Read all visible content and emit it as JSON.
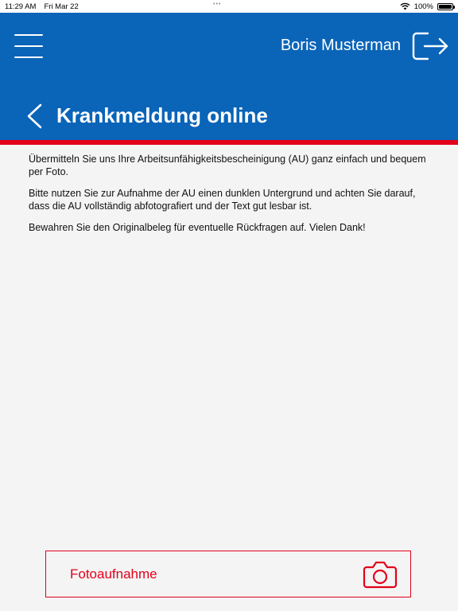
{
  "status_bar": {
    "time": "11:29 AM",
    "date": "Fri Mar 22",
    "battery": "100%",
    "dots": "•••"
  },
  "header": {
    "user_name": "Boris Musterman",
    "title": "Krankmeldung online",
    "background_color": "#0a64b8",
    "accent_color": "#e3001b",
    "menu_icon": "hamburger-menu-icon",
    "logout_icon": "logout-icon",
    "back_icon": "chevron-left-icon"
  },
  "content": {
    "paragraphs": [
      "Übermitteln Sie uns Ihre Arbeitsunfähigkeitsbescheinigung (AU) ganz einfach und bequem per Foto.",
      "Bitte nutzen Sie zur Aufnahme der AU einen dunklen Untergrund und achten Sie darauf, dass die AU vollständig abfotografiert und der Text gut lesbar ist.",
      "Bewahren Sie den Originalbeleg für eventuelle Rückfragen auf. Vielen Dank!"
    ]
  },
  "photo_button": {
    "label": "Fotoaufnahme",
    "icon": "camera-icon"
  }
}
